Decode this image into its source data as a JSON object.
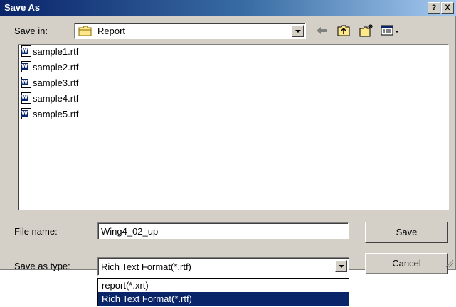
{
  "window": {
    "title": "Save As"
  },
  "titlebar": {
    "help_label": "?",
    "close_label": "X"
  },
  "save_in": {
    "label": "Save in:",
    "value": "Report"
  },
  "toolbar": {
    "back_icon": "back-arrow-icon",
    "up_icon": "up-folder-icon",
    "new_folder_icon": "new-folder-icon",
    "views_icon": "views-menu-icon"
  },
  "files": [
    {
      "name": "sample1.rtf"
    },
    {
      "name": "sample2.rtf"
    },
    {
      "name": "sample3.rtf"
    },
    {
      "name": "sample4.rtf"
    },
    {
      "name": "sample5.rtf"
    }
  ],
  "file_name": {
    "label": "File name:",
    "value": "Wing4_02_up"
  },
  "save_as_type": {
    "label": "Save as type:",
    "value": "Rich Text Format(*.rtf)",
    "options": [
      "report(*.xrt)",
      "Rich Text Format(*.rtf)"
    ],
    "selected_index": 1
  },
  "buttons": {
    "save": "Save",
    "cancel": "Cancel"
  },
  "colors": {
    "selection": "#0a246a",
    "dialog_bg": "#d4d0c8",
    "title_start": "#0a246a",
    "title_end": "#a6caf0"
  }
}
